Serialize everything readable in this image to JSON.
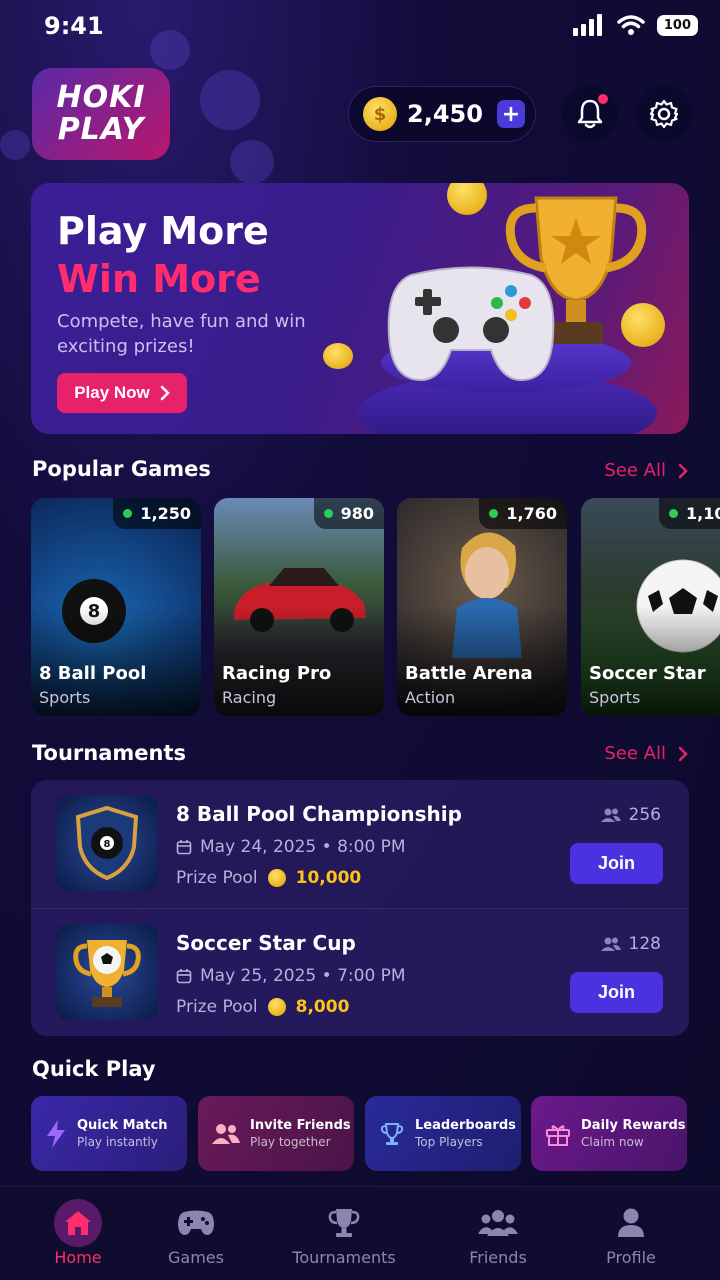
{
  "status": {
    "time": "9:41",
    "battery": "100"
  },
  "brand": {
    "line1": "HOKI",
    "line2": "PLAY"
  },
  "wallet": {
    "coins": "2,450",
    "add": "+"
  },
  "hero": {
    "title_line1": "Play More",
    "title_line2": "Win More",
    "subtitle": "Compete, have fun and win exciting prizes!",
    "cta": "Play Now"
  },
  "popular": {
    "title": "Popular Games",
    "see_all": "See All",
    "games": [
      {
        "name": "8 Ball Pool",
        "category": "Sports",
        "players": "1,250"
      },
      {
        "name": "Racing Pro",
        "category": "Racing",
        "players": "980"
      },
      {
        "name": "Battle Arena",
        "category": "Action",
        "players": "1,760"
      },
      {
        "name": "Soccer Star",
        "category": "Sports",
        "players": "1,10"
      }
    ]
  },
  "tournaments": {
    "title": "Tournaments",
    "see_all": "See All",
    "items": [
      {
        "name": "8 Ball Pool Championship",
        "date": "May 24, 2025 • 8:00 PM",
        "prize_label": "Prize Pool",
        "prize": "10,000",
        "players": "256",
        "join": "Join"
      },
      {
        "name": "Soccer Star Cup",
        "date": "May 25, 2025 • 7:00 PM",
        "prize_label": "Prize Pool",
        "prize": "8,000",
        "players": "128",
        "join": "Join"
      }
    ]
  },
  "quick_play": {
    "title": "Quick Play",
    "items": [
      {
        "title": "Quick Match",
        "sub": "Play instantly"
      },
      {
        "title": "Invite Friends",
        "sub": "Play together"
      },
      {
        "title": "Leaderboards",
        "sub": "Top Players"
      },
      {
        "title": "Daily Rewards",
        "sub": "Claim now"
      }
    ]
  },
  "nav": {
    "items": [
      {
        "label": "Home"
      },
      {
        "label": "Games"
      },
      {
        "label": "Tournaments"
      },
      {
        "label": "Friends"
      },
      {
        "label": "Profile"
      }
    ]
  },
  "colors": {
    "accent": "#e8226a",
    "primary": "#4a32e0",
    "gold": "#ffc21a"
  }
}
